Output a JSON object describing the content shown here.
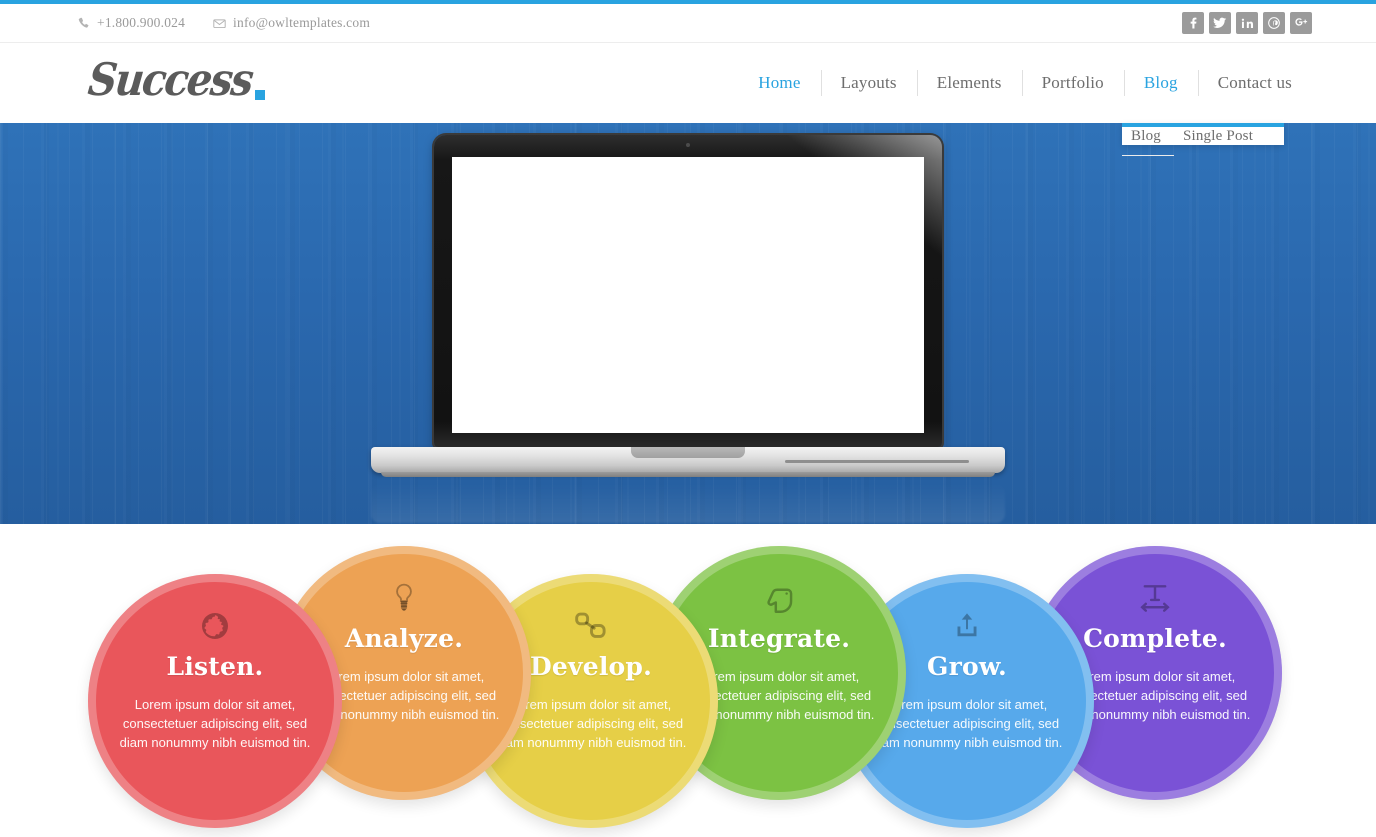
{
  "topbar": {
    "phone": "+1.800.900.024",
    "phone_icon": "phone-icon",
    "email": "info@owltemplates.com",
    "email_icon": "envelope-icon",
    "social": [
      {
        "name": "facebook-icon",
        "glyph": "f"
      },
      {
        "name": "twitter-icon",
        "glyph": "t"
      },
      {
        "name": "linkedin-icon",
        "glyph": "in"
      },
      {
        "name": "pinterest-icon",
        "glyph": "P"
      },
      {
        "name": "googleplus-icon",
        "glyph": "g+"
      }
    ]
  },
  "header": {
    "logo_text": "Success",
    "logo_accent_color": "#29A3E0"
  },
  "nav": {
    "items": [
      {
        "label": "Home",
        "active": true
      },
      {
        "label": "Layouts",
        "active": false
      },
      {
        "label": "Elements",
        "active": false
      },
      {
        "label": "Portfolio",
        "active": false
      },
      {
        "label": "Blog",
        "active": true
      },
      {
        "label": "Contact us",
        "active": false
      }
    ],
    "dropdown": {
      "parent": "Blog",
      "accent_color": "#29A3E0",
      "items": [
        {
          "label": "Blog"
        },
        {
          "label": "Single Post"
        }
      ]
    }
  },
  "hero": {
    "background_color": "#2A68AE",
    "device": "laptop-mockup",
    "screen_content": ""
  },
  "features": {
    "body_text": "Lorem ipsum dolor sit amet, consectetuer adipiscing elit, sed diam nonummy nibh euismod tin.",
    "items": [
      {
        "title": "Listen.",
        "icon": "globe-icon",
        "color": "#E9565B"
      },
      {
        "title": "Analyze.",
        "icon": "lightbulb-icon",
        "color": "#EDA254"
      },
      {
        "title": "Develop.",
        "icon": "link-icon",
        "color": "#E6CF47"
      },
      {
        "title": "Integrate.",
        "icon": "hand-point-up-icon",
        "color": "#7CC243"
      },
      {
        "title": "Grow.",
        "icon": "upload-icon",
        "color": "#57A9EB"
      },
      {
        "title": "Complete.",
        "icon": "text-width-icon",
        "color": "#7A52D6"
      }
    ]
  }
}
